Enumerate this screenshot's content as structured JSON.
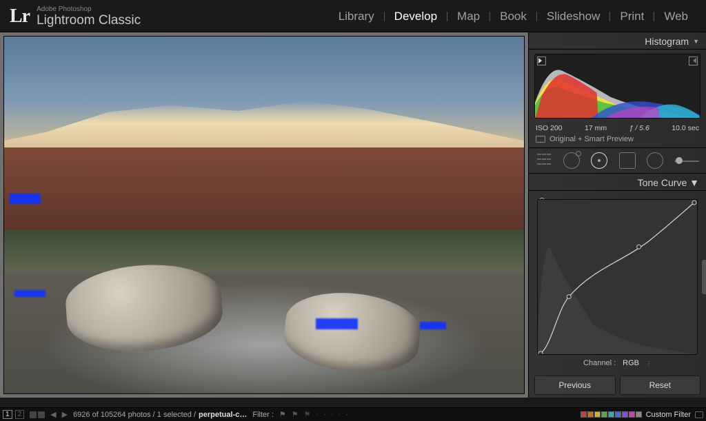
{
  "header": {
    "logo_mark": "Lr",
    "logo_supt": "Adobe Photoshop",
    "logo_main": "Lightroom Classic",
    "modules": [
      "Library",
      "Develop",
      "Map",
      "Book",
      "Slideshow",
      "Print",
      "Web"
    ],
    "active": "Develop"
  },
  "histogram": {
    "title": "Histogram",
    "iso": "ISO 200",
    "focal": "17 mm",
    "aperture": "ƒ / 5.6",
    "shutter": "10.0 sec",
    "preview": "Original + Smart Preview"
  },
  "tone_curve": {
    "title": "Tone Curve",
    "channel_label": "Channel :",
    "channel_value": "RGB",
    "previous": "Previous",
    "reset": "Reset"
  },
  "footer": {
    "xy_index": "1",
    "xy_index2": "2",
    "status": "6926 of 105264 photos / 1 selected /",
    "folder": "perpetual-c…",
    "filter_label": "Filter :",
    "filter_name": "Custom Filter"
  },
  "swatch_colors": [
    "#c04040",
    "#c76a34",
    "#c7b234",
    "#5aa84a",
    "#4aa0a8",
    "#4a6ad0",
    "#8a4ad0",
    "#c04ab0",
    "#888"
  ]
}
